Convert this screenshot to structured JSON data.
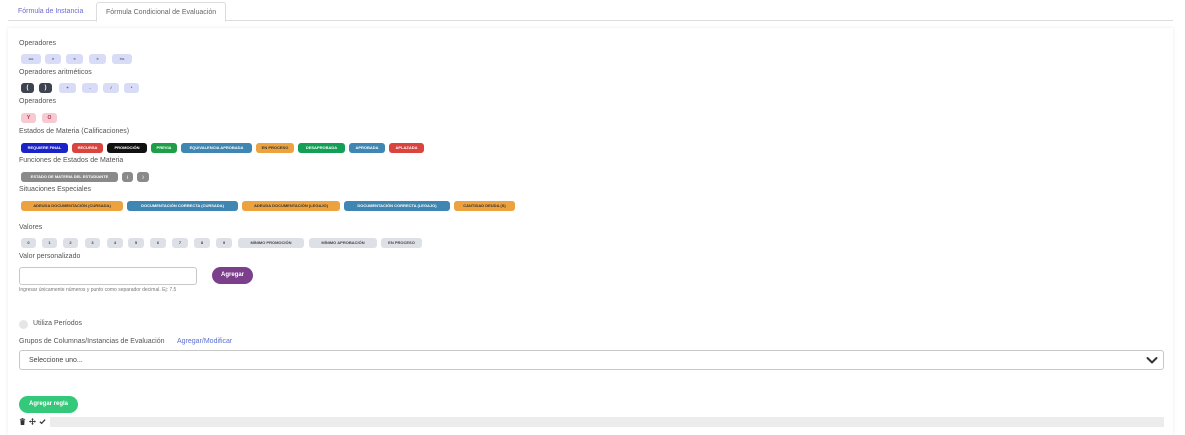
{
  "tabs": [
    {
      "label": "Fórmula de Instancia"
    },
    {
      "label": "Fórmula Condicional de Evaluación"
    }
  ],
  "sections": {
    "operadores": "Operadores",
    "aritmeticos": "Operadores aritméticos",
    "operadores2": "Operadores",
    "estados": "Estados de Materia (Calificaciones)",
    "funciones": "Funciones de Estados de Materia",
    "situaciones": "Situaciones Especiales",
    "valores": "Valores",
    "personalizado": "Valor personalizado"
  },
  "operators": [
    "==",
    ">",
    "<",
    ">",
    ">="
  ],
  "arith": [
    "(",
    ")",
    "+",
    "-",
    "/",
    "*"
  ],
  "logic": [
    "Y",
    "O"
  ],
  "estados": [
    {
      "label": "REQUIERE FINAL",
      "color": "#1b22c7"
    },
    {
      "label": "RECURSA",
      "color": "#d9443e"
    },
    {
      "label": "PROMOCIÓN",
      "color": "#111111"
    },
    {
      "label": "PREVIA",
      "color": "#1f9e4a"
    },
    {
      "label": "EQUIVALENCIA APROBADA",
      "color": "#3f86b3"
    },
    {
      "label": "EN PROCESO",
      "color": "#eba23f"
    },
    {
      "label": "DESAPROBADA",
      "color": "#139f55"
    },
    {
      "label": "APROBADA",
      "color": "#3f86b3"
    },
    {
      "label": "APLAZADA",
      "color": "#d9443e"
    }
  ],
  "funciones": [
    "ESTADO DE MATERIA DEL ESTUDIANTE",
    "(",
    ")"
  ],
  "situaciones": [
    {
      "label": "ADEUDA DOCUMENTACIÓN (CURSADA)",
      "color": "#eba23f"
    },
    {
      "label": "DOCUMENTACIÓN CORRECTA (CURSADA)",
      "color": "#3f86b3"
    },
    {
      "label": "ADEUDA DOCUMENTACIÓN (LEGAJO)",
      "color": "#eba23f"
    },
    {
      "label": "DOCUMENTACIÓN CORRECTA (LEGAJO)",
      "color": "#3f86b3"
    },
    {
      "label": "CANTIDAD DEUDA (S)",
      "color": "#eba23f"
    }
  ],
  "valores": [
    "0",
    "1",
    "2",
    "3",
    "4",
    "5",
    "6",
    "7",
    "8",
    "9",
    "MÍNIMO PROMOCIÓN",
    "MÍNIMO APROBACIÓN",
    "EN PROCESO"
  ],
  "custom": {
    "value": "",
    "button": "Agregar",
    "help": "Ingresar únicamente números y punto como separador decimal. Ej: 7.5"
  },
  "periodos": {
    "label": "Utiliza Períodos",
    "checked": false
  },
  "grupos": {
    "label": "Grupos de Columnas/Instancias de Evaluación",
    "link": "Agregar/Modificar"
  },
  "select": {
    "value": "Seleccione uno..."
  },
  "add_rule": "Agregar regla",
  "icons": [
    "trash-icon",
    "move-icon",
    "check-icon"
  ]
}
